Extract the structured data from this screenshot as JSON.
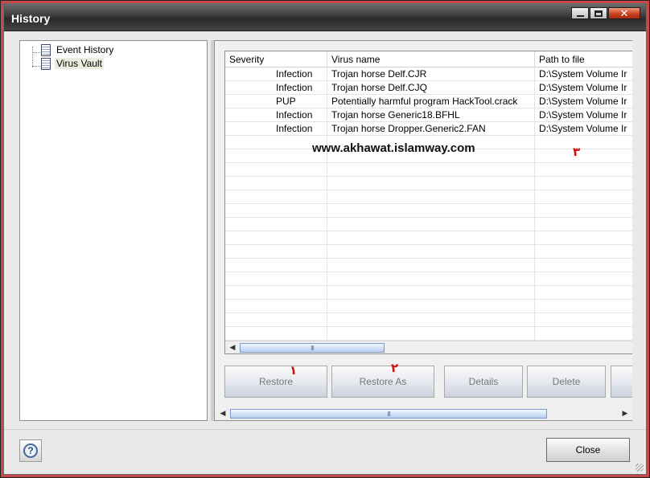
{
  "window": {
    "title": "History",
    "minimize_label": "minimize",
    "maximize_label": "maximize",
    "close_label": "close"
  },
  "tree": {
    "items": [
      {
        "label": "Event History",
        "icon": "document-icon",
        "selected": false
      },
      {
        "label": "Virus Vault",
        "icon": "document-icon",
        "selected": true
      }
    ]
  },
  "table": {
    "columns": [
      "Severity",
      "Virus name",
      "Path to file"
    ],
    "rows": [
      {
        "severity": "Infection",
        "virus": "Trojan horse Delf.CJR",
        "path": "D:\\System Volume Ir"
      },
      {
        "severity": "Infection",
        "virus": "Trojan horse Delf.CJQ",
        "path": "D:\\System Volume Ir"
      },
      {
        "severity": "PUP",
        "virus": "Potentially harmful program HackTool.crack",
        "path": "D:\\System Volume Ir"
      },
      {
        "severity": "Infection",
        "virus": "Trojan horse Generic18.BFHL",
        "path": "D:\\System Volume Ir"
      },
      {
        "severity": "Infection",
        "virus": "Trojan horse Dropper.Generic2.FAN",
        "path": "D:\\System Volume Ir"
      }
    ]
  },
  "overlay": {
    "watermark": "www.akhawat.islamway.com",
    "marks": [
      "١",
      "٢",
      "٣"
    ],
    "mark_color": "#d21010"
  },
  "actions": {
    "restore": "Restore",
    "restore_as": "Restore As",
    "details": "Details",
    "delete": "Delete"
  },
  "footer": {
    "help_icon": "?",
    "close": "Close"
  },
  "scroll": {
    "grip_glyph": "III"
  }
}
